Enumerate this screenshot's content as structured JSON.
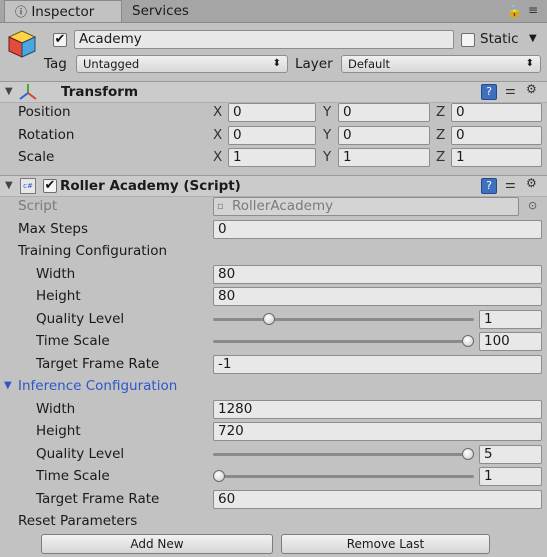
{
  "tabs": [
    {
      "label": "Inspector"
    },
    {
      "label": "Services"
    }
  ],
  "object": {
    "name": "Academy",
    "static_label": "Static",
    "tag_label": "Tag",
    "tag_value": "Untagged",
    "layer_label": "Layer",
    "layer_value": "Default",
    "active": true,
    "static": false
  },
  "transform": {
    "title": "Transform",
    "axis_x": "X",
    "axis_y": "Y",
    "axis_z": "Z",
    "rows": [
      {
        "label": "Position",
        "x": "0",
        "y": "0",
        "z": "0"
      },
      {
        "label": "Rotation",
        "x": "0",
        "y": "0",
        "z": "0"
      },
      {
        "label": "Scale",
        "x": "1",
        "y": "1",
        "z": "1"
      }
    ]
  },
  "script_component": {
    "title": "Roller Academy (Script)",
    "enabled": true,
    "script_label": "Script",
    "script_value": "RollerAcademy",
    "max_steps_label": "Max Steps",
    "max_steps_value": "0",
    "training": {
      "header": "Training Configuration",
      "width_label": "Width",
      "width_value": "80",
      "height_label": "Height",
      "height_value": "80",
      "quality_label": "Quality Level",
      "quality_value": "1",
      "quality_fraction": 0.2,
      "timescale_label": "Time Scale",
      "timescale_value": "100",
      "timescale_fraction": 1.0,
      "fps_label": "Target Frame Rate",
      "fps_value": "-1"
    },
    "inference": {
      "header": "Inference Configuration",
      "width_label": "Width",
      "width_value": "1280",
      "height_label": "Height",
      "height_value": "720",
      "quality_label": "Quality Level",
      "quality_value": "5",
      "quality_fraction": 1.0,
      "timescale_label": "Time Scale",
      "timescale_value": "1",
      "timescale_fraction": 0.0,
      "fps_label": "Target Frame Rate",
      "fps_value": "60"
    },
    "reset_label": "Reset Parameters",
    "add_new_label": "Add New",
    "remove_last_label": "Remove Last"
  },
  "colors": {
    "accent_blue": "#2b57c9",
    "panel_bg": "#c2c2c2"
  },
  "icons": [
    "lock-icon",
    "menu-icon",
    "cube-icon",
    "transform-axes-icon",
    "help-icon",
    "settings-sliders-icon",
    "gear-icon",
    "script-icon",
    "target-icon",
    "fold-arrow-icon"
  ]
}
